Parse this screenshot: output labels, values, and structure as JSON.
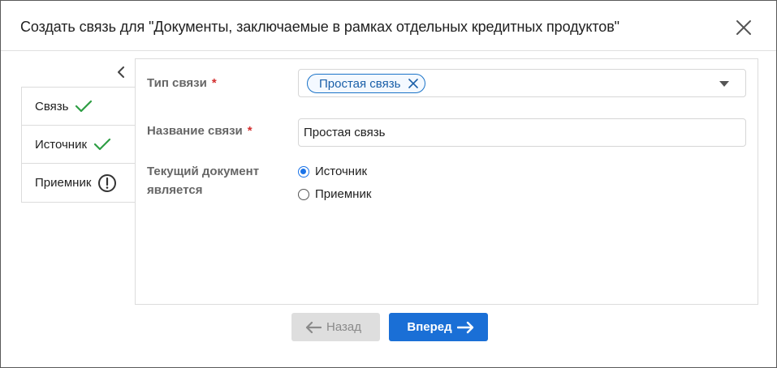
{
  "dialog": {
    "title": "Создать связь для \"Документы, заключаемые в рамках отдельных кредитных продуктов\""
  },
  "steps": [
    {
      "label": "Связь",
      "status": "done"
    },
    {
      "label": "Источник",
      "status": "done"
    },
    {
      "label": "Приемник",
      "status": "warning"
    }
  ],
  "form": {
    "link_type": {
      "label": "Тип связи",
      "required_mark": "*",
      "selected": "Простая связь"
    },
    "link_name": {
      "label": "Название связи",
      "required_mark": "*",
      "value": "Простая связь"
    },
    "current_doc": {
      "label_line1": "Текущий документ",
      "label_line2": "является",
      "options": [
        {
          "label": "Источник",
          "checked": true
        },
        {
          "label": "Приемник",
          "checked": false
        }
      ]
    }
  },
  "footer": {
    "back_label": "Назад",
    "next_label": "Вперед"
  },
  "colors": {
    "accent": "#1a6fd6",
    "done": "#2e9e44",
    "required": "#d32f2f"
  }
}
